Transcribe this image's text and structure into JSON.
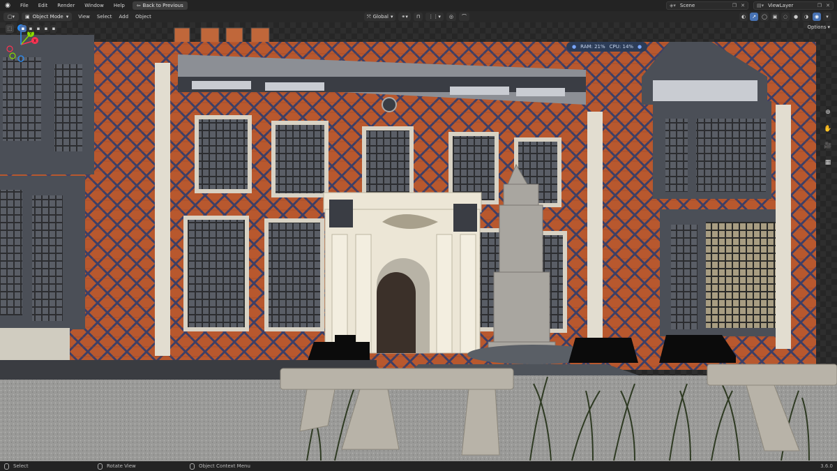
{
  "topbar": {
    "menu": [
      "File",
      "Edit",
      "Render",
      "Window",
      "Help"
    ],
    "back_button": "Back to Previous",
    "scene_name": "Scene",
    "view_layer": "ViewLayer"
  },
  "viewport_header": {
    "mode": "Object Mode",
    "menu": [
      "View",
      "Select",
      "Add",
      "Object"
    ],
    "transform_orientation": "Global",
    "options_label": "Options"
  },
  "stats": {
    "ram": "RAM: 21%",
    "cpu": "CPU: 14%"
  },
  "gizmo": {
    "x_label": "X",
    "y_label": "Y",
    "z_label": "Z"
  },
  "statusbar": {
    "select": "Select",
    "rotate_view": "Rotate View",
    "context_menu": "Object Context Menu",
    "version": "3.6.0"
  },
  "colors": {
    "accent": "#4772b3",
    "gizmo_x": "#ff3352",
    "gizmo_y": "#8bdc00",
    "gizmo_z": "#2890ff",
    "brick": "#b8582e",
    "stone": "#e8e2d3"
  }
}
